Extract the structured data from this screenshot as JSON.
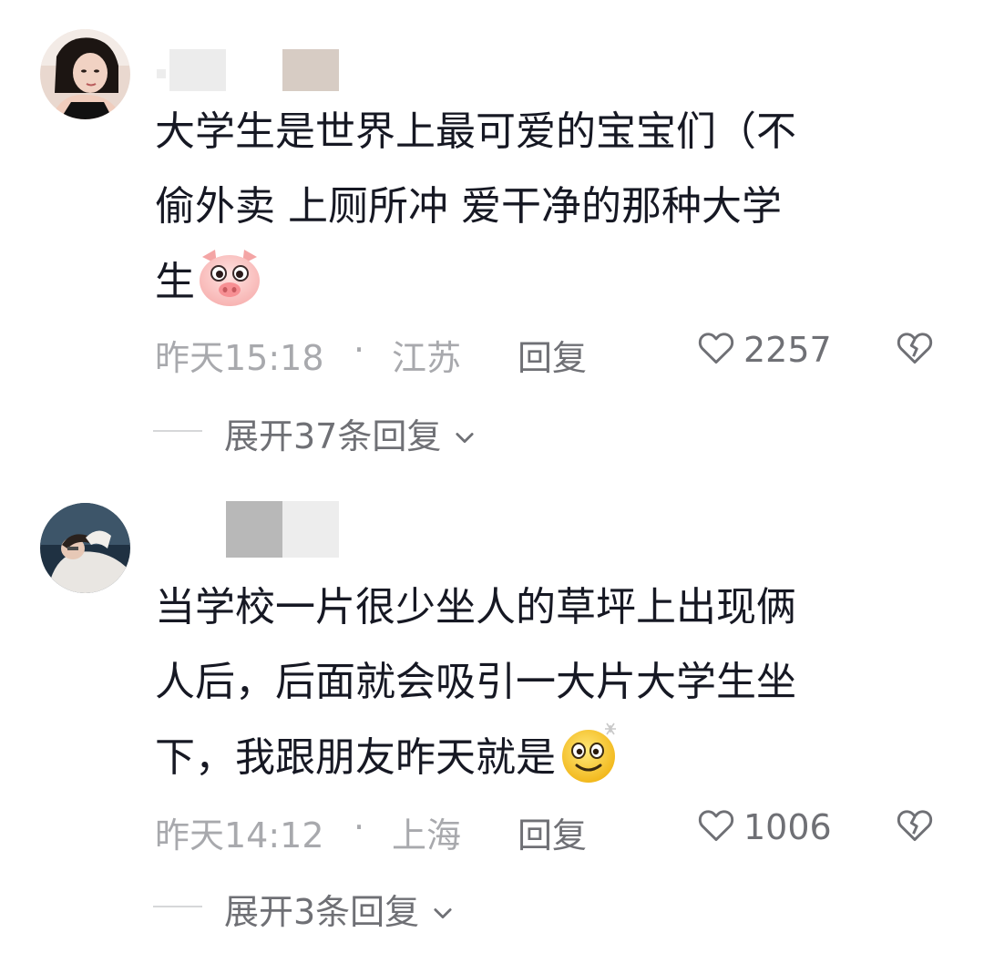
{
  "comments": [
    {
      "text_before_emoji": "大学生是世界上最可爱的宝宝们（不\n偷外卖 上厕所冲 爱干净的那种大学\n生",
      "emoji": "pig-face-emoji",
      "time": "昨天15:18",
      "separator": "·",
      "location": "江苏",
      "reply_label": "回复",
      "likes": "2257",
      "expand_label": "展开37条回复",
      "expand_icon": "chevron-down-icon"
    },
    {
      "text_before_emoji": "当学校一片很少坐人的草坪上出现俩\n人后，后面就会吸引一大片大学生坐\n下，我跟朋友昨天就是",
      "emoji": "dizzy-smile-emoji",
      "time": "昨天14:12",
      "separator": "·",
      "location": "上海",
      "reply_label": "回复",
      "likes": "1006",
      "expand_label": "展开3条回复",
      "expand_icon": "chevron-down-icon"
    }
  ],
  "colors": {
    "text": "#161823",
    "meta": "#a8a9ad",
    "secondary": "#6f7075"
  }
}
